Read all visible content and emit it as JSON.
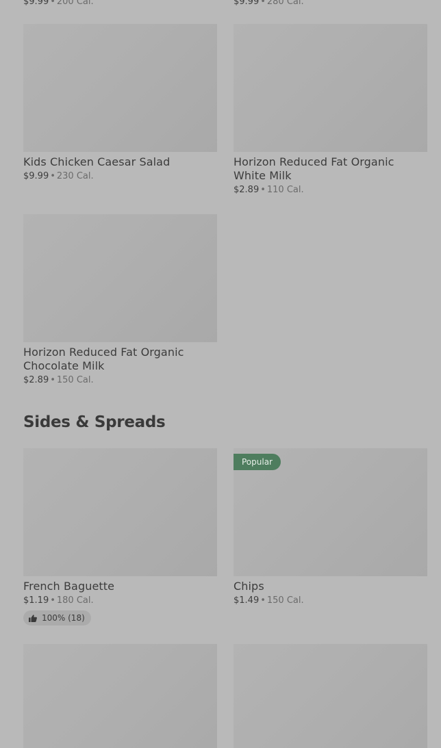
{
  "top_partial": [
    {
      "price": "$9.99",
      "cal": "200 Cal."
    },
    {
      "price": "$9.99",
      "cal": "280 Cal."
    }
  ],
  "items_row1": [
    {
      "name": "Kids Chicken Caesar Salad",
      "price": "$9.99",
      "cal": "230 Cal."
    },
    {
      "name": "Horizon Reduced Fat Organic White Milk",
      "price": "$2.89",
      "cal": "110 Cal."
    }
  ],
  "items_row2": [
    {
      "name": "Horizon Reduced Fat Organic Chocolate Milk",
      "price": "$2.89",
      "cal": "150 Cal."
    }
  ],
  "section": {
    "title": "Sides & Spreads"
  },
  "sides_row1": [
    {
      "name": "French Baguette",
      "price": "$1.19",
      "cal": "180 Cal.",
      "rating": "100% (18)"
    },
    {
      "name": "Chips",
      "price": "$1.49",
      "cal": "150 Cal.",
      "badge": "Popular"
    }
  ],
  "separator": "•",
  "icons": {
    "thumbs_up": "thumbs-up-icon"
  }
}
